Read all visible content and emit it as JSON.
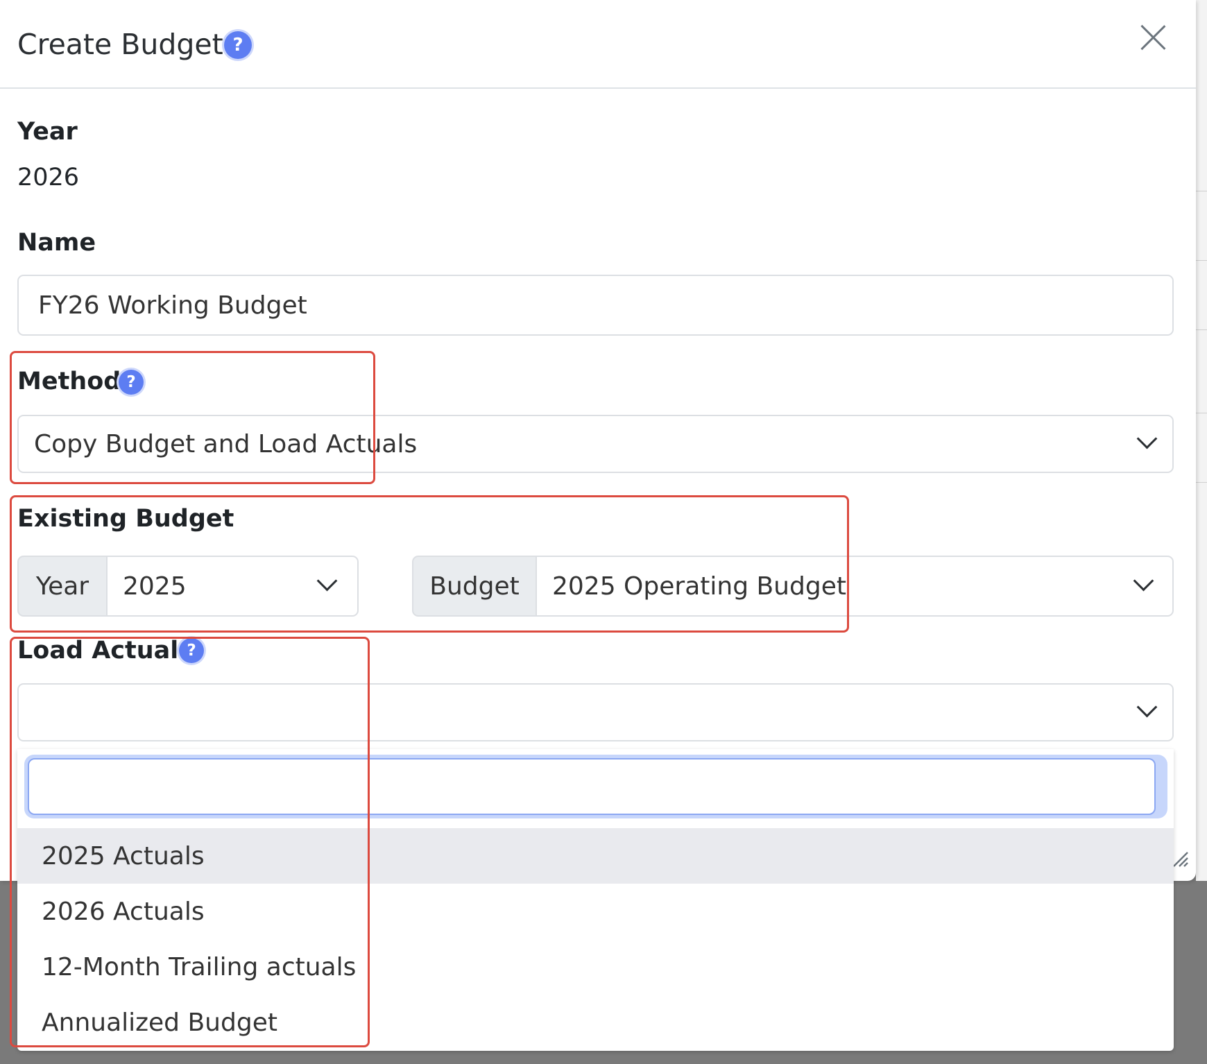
{
  "modal": {
    "title": "Create Budget",
    "help_icon": "question-circle-icon",
    "close_icon": "close-icon"
  },
  "year_field": {
    "label": "Year",
    "value": "2026"
  },
  "name_field": {
    "label": "Name",
    "value": "FY26 Working Budget"
  },
  "method_field": {
    "label": "Method",
    "selected": "Copy Budget and Load Actuals"
  },
  "existing_budget": {
    "label": "Existing Budget",
    "year_addon": "Year",
    "year_selected": "2025",
    "budget_addon": "Budget",
    "budget_selected": "2025 Operating Budget"
  },
  "load_actuals": {
    "label": "Load Actuals",
    "selected": "",
    "search_value": "",
    "options": [
      "2025 Actuals",
      "2026 Actuals",
      "12-Month Trailing actuals",
      "Annualized Budget"
    ],
    "highlighted_option": "2025 Actuals"
  },
  "colors": {
    "help_icon": "#5d7df2",
    "annotation_border": "#dc4a3f",
    "focus_ring": "#c7d6fb",
    "overlay": "#7a7a7a"
  }
}
